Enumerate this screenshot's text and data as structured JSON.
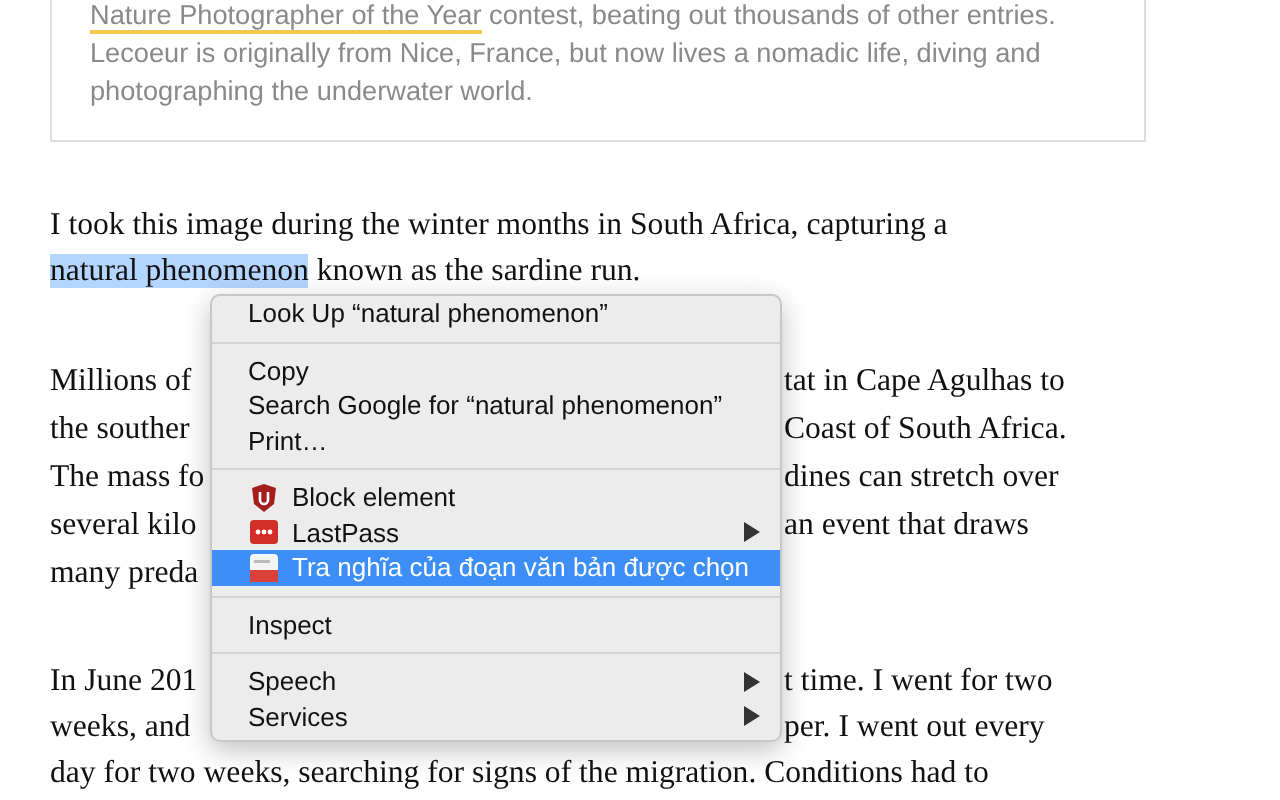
{
  "caption": {
    "link": "Nature Photographer of the Year",
    "lines": [
      " contest, beating out thousands of other entries.",
      "Lecoeur is originally from Nice, France, but now lives a nomadic life, diving and",
      "photographing the underwater world."
    ]
  },
  "article": [
    {
      "lines": [
        {
          "text": "I took this image during the winter months in South Africa, capturing a"
        },
        {
          "selection": "natural phenomenon",
          "text": " known as the sardine run."
        }
      ]
    },
    {
      "lines": [
        {
          "left": "Millions of",
          "right": "tat in Cape Agulhas to"
        },
        {
          "left": "the souther",
          "right": "Coast of South Africa."
        },
        {
          "left": "The mass fo",
          "right": "dines can stretch over"
        },
        {
          "left": "several kilo",
          "right": "an event that draws"
        },
        {
          "left": "many preda"
        }
      ]
    },
    {
      "lines": [
        {
          "left": "In June 201",
          "right": "t time. I went for two"
        },
        {
          "left": "weeks, and",
          "right": "per. I went out every"
        },
        {
          "text": "day for two weeks, searching for signs of the migration. Conditions had to"
        }
      ]
    }
  ],
  "menu": {
    "items": [
      {
        "kind": "item",
        "label": "Look Up “natural phenomenon”",
        "submenu": false,
        "selected": false
      },
      {
        "kind": "separator"
      },
      {
        "kind": "item",
        "label": "Copy",
        "submenu": false,
        "selected": false
      },
      {
        "kind": "item",
        "label": "Search Google for “natural phenomenon”",
        "submenu": false,
        "selected": false
      },
      {
        "kind": "item",
        "label": "Print…",
        "submenu": false,
        "selected": false
      },
      {
        "kind": "separator"
      },
      {
        "kind": "adblock",
        "label": "Block element",
        "submenu": false,
        "selected": false
      },
      {
        "kind": "password",
        "label": "LastPass",
        "submenu": true,
        "selected": false
      },
      {
        "kind": "dictionary",
        "label": "Tra nghĩa của đoạn văn bản được chọn",
        "submenu": false,
        "selected": true
      },
      {
        "kind": "separator"
      },
      {
        "kind": "item",
        "label": "Inspect",
        "submenu": false,
        "selected": false
      },
      {
        "kind": "separator"
      },
      {
        "kind": "item",
        "label": "Speech",
        "submenu": true,
        "selected": false
      },
      {
        "kind": "item",
        "label": "Services",
        "submenu": true,
        "selected": false
      }
    ]
  }
}
